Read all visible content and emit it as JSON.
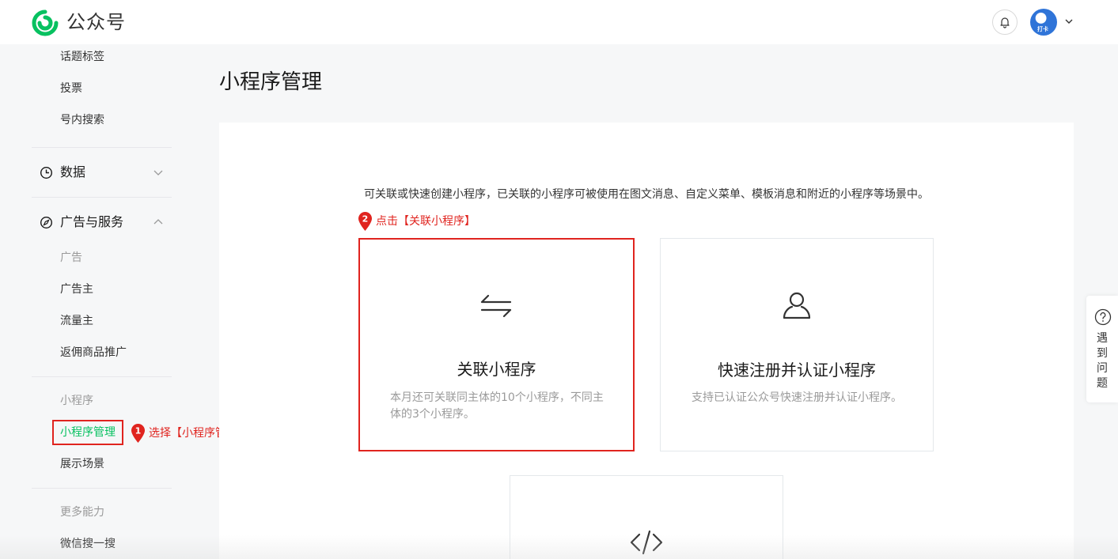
{
  "header": {
    "brand": "公众号",
    "brand_color": "#07c160",
    "logo_icon": "wechat-official-account-logo-icon",
    "notification_icon": "bell-icon",
    "avatar_badge": "打卡"
  },
  "sidebar": {
    "items_top": [
      "话题标签",
      "投票",
      "号内搜索"
    ],
    "sections": [
      {
        "label": "数据",
        "icon": "clock-icon",
        "expanded": false
      },
      {
        "label": "广告与服务",
        "icon": "compass-icon",
        "expanded": true
      }
    ],
    "groups": {
      "ads_title": "广告",
      "ads_items": [
        "广告主",
        "流量主",
        "返佣商品推广"
      ],
      "mini_title": "小程序",
      "mini_active": "小程序管理",
      "mini_items": [
        "展示场景"
      ],
      "more_title": "更多能力",
      "more_items": [
        "微信搜一搜"
      ]
    }
  },
  "annotations": {
    "step1_number": "1",
    "step1_text": "选择【小程序管理】",
    "step2_number": "2",
    "step2_text": "点击【关联小程序】",
    "highlight_color": "#e0241f"
  },
  "main": {
    "page_title": "小程序管理",
    "intro": "可关联或快速创建小程序，已关联的小程序可被使用在图文消息、自定义菜单、模板消息和附近的小程序等场景中。",
    "cards": [
      {
        "icon": "swap-arrows-icon",
        "title": "关联小程序",
        "desc": "本月还可关联同主体的10个小程序，不同主体的3个小程序。"
      },
      {
        "icon": "user-icon",
        "title": "快速注册并认证小程序",
        "desc": "支持已认证公众号快速注册并认证小程序。"
      },
      {
        "icon": "code-icon",
        "title": "",
        "desc": ""
      }
    ]
  },
  "help": {
    "icon": "question-circle-icon",
    "label": "遇到问题"
  }
}
